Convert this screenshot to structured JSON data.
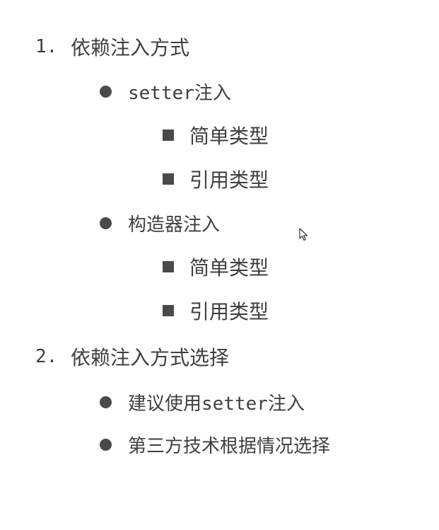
{
  "sections": [
    {
      "number": "1.",
      "title": "依赖注入方式",
      "items": [
        {
          "label_mono": "setter",
          "label_rest": "注入",
          "subitems": [
            "简单类型",
            "引用类型"
          ]
        },
        {
          "label_mono": "",
          "label_rest": "构造器注入",
          "subitems": [
            "简单类型",
            "引用类型"
          ]
        }
      ]
    },
    {
      "number": "2.",
      "title": "依赖注入方式选择",
      "items": [
        {
          "label_pre": "建议使用",
          "label_mono": "setter",
          "label_rest": "注入"
        },
        {
          "label_rest": "第三方技术根据情况选择"
        }
      ]
    }
  ],
  "icons": {
    "cursor": "mouse-pointer-icon",
    "bullet_level2": "circle-bullet-icon",
    "bullet_level3": "square-bullet-icon"
  },
  "colors": {
    "text": "#3f3f3f",
    "bullet": "#4a4a4a",
    "background": "#ffffff"
  }
}
